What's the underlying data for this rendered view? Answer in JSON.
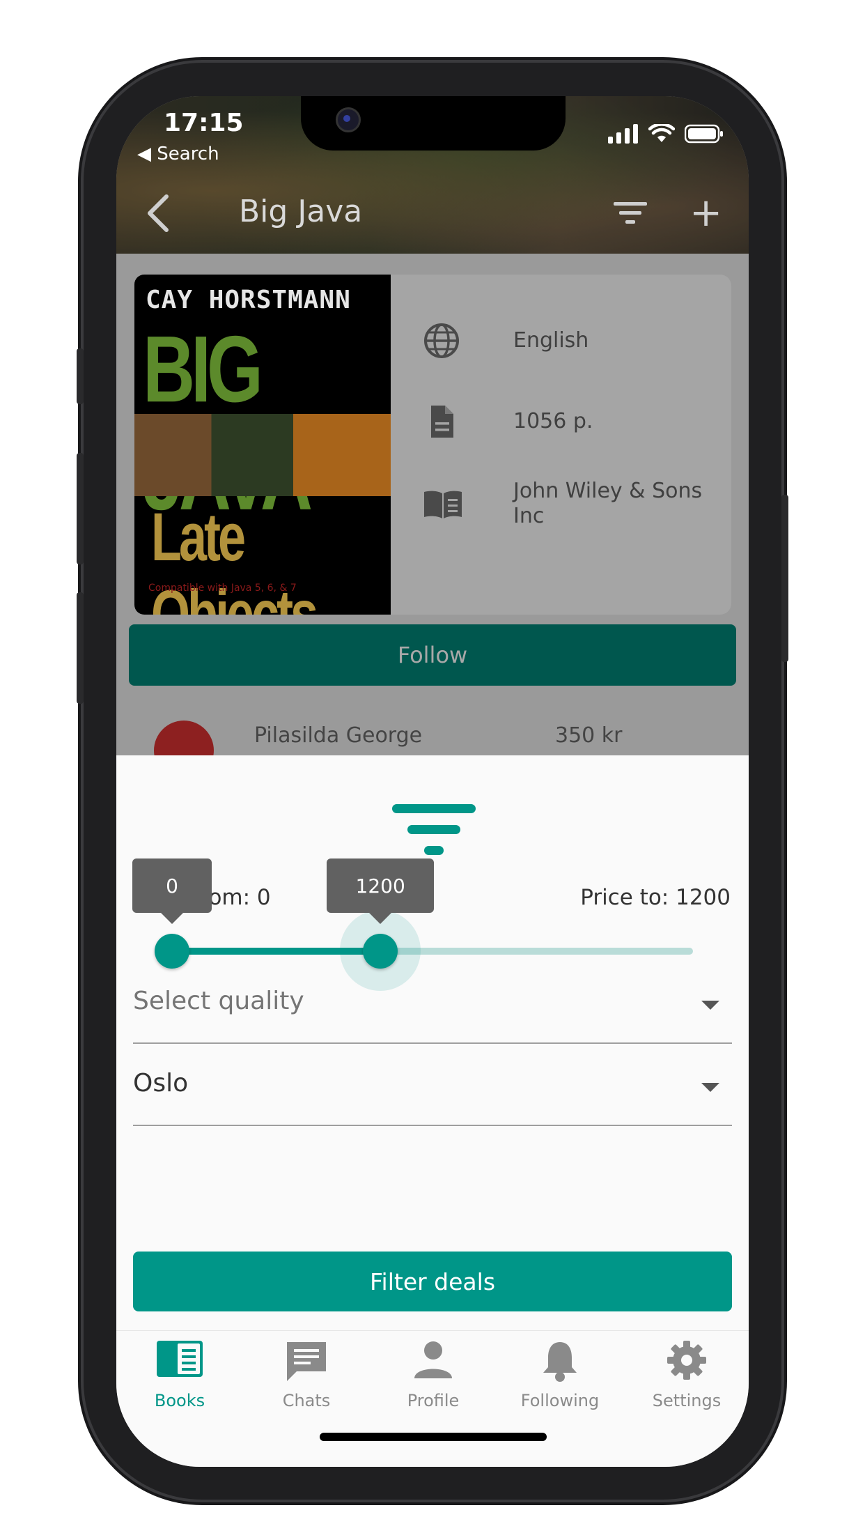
{
  "status_bar": {
    "time": "17:15",
    "back_label": "◀ Search"
  },
  "app_bar": {
    "title": "Big Java"
  },
  "book": {
    "cover": {
      "author": "CAY HORSTMANN",
      "title": "BIG JAVA",
      "subtitle": "Late Objects",
      "small": "Compatible with Java 5, 6, & 7"
    },
    "language": "English",
    "pages": "1056 p.",
    "publisher": "John Wiley & Sons Inc"
  },
  "follow_label": "Follow",
  "seller_preview": {
    "name": "Pilasilda George",
    "price": "350 kr"
  },
  "filter": {
    "price_from_label": "Price from: 0",
    "price_to_label": "Price to: 1200",
    "slider": {
      "min_tooltip": "0",
      "max_tooltip": "1200",
      "low_fraction": 0.0,
      "high_fraction": 0.4
    },
    "quality_placeholder": "Select quality",
    "city_value": "Oslo",
    "submit_label": "Filter deals"
  },
  "bottom_nav": [
    {
      "label": "Books",
      "icon": "book-icon",
      "active": true
    },
    {
      "label": "Chats",
      "icon": "chat-icon",
      "active": false
    },
    {
      "label": "Profile",
      "icon": "person-icon",
      "active": false
    },
    {
      "label": "Following",
      "icon": "bell-icon",
      "active": false
    },
    {
      "label": "Settings",
      "icon": "gear-icon",
      "active": false
    }
  ],
  "colors": {
    "accent": "#009688",
    "follow_button": "#00574e",
    "inactive_nav": "#8a8a8a"
  }
}
